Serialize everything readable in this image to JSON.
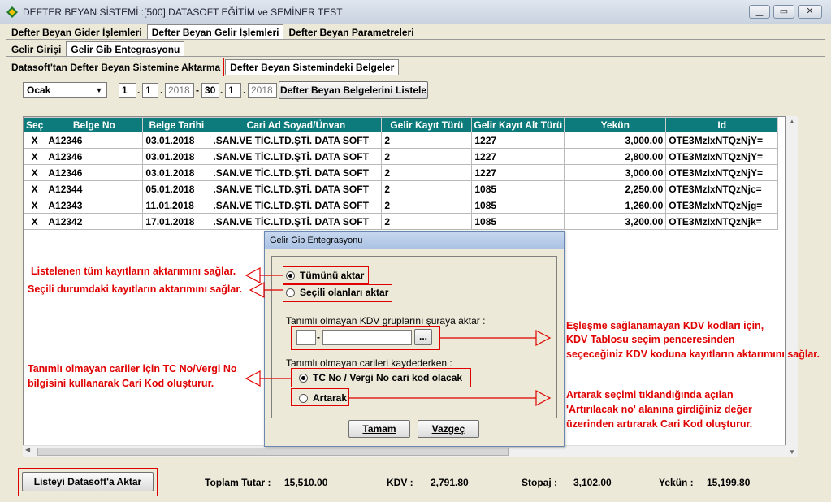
{
  "window": {
    "title": "DEFTER BEYAN SİSTEMİ :[500]  DATASOFT EĞİTİM ve SEMİNER TEST"
  },
  "tabs_main": [
    "Defter Beyan Gider İşlemleri",
    "Defter Beyan Gelir İşlemleri",
    "Defter Beyan Parametreleri"
  ],
  "tabs_sub": [
    "Gelir Girişi",
    "Gelir Gib Entegrasyonu"
  ],
  "tabs_sub2": [
    "Datasoft'tan Defter Beyan Sistemine Aktarma",
    "Defter Beyan Sistemindeki Belgeler"
  ],
  "filter": {
    "month": "Ocak",
    "d1": "1",
    "m1": "1",
    "y1": "2018",
    "d2": "30",
    "m2": "1",
    "y2": "2018",
    "list_button": "Defter Beyan Belgelerini Listele"
  },
  "grid": {
    "columns": [
      "Seç",
      "Belge No",
      "Belge Tarihi",
      "Cari Ad Soyad/Ünvan",
      "Gelir Kayıt Türü",
      "Gelir Kayıt Alt Türü",
      "Yekün",
      "Id"
    ],
    "rows": [
      [
        "X",
        "A12346",
        "03.01.2018",
        ".SAN.VE TİC.LTD.ŞTİ. DATA SOFT",
        "2",
        "1227",
        "3,000.00",
        "OTE3MzIxNTQzNjY="
      ],
      [
        "X",
        "A12346",
        "03.01.2018",
        ".SAN.VE TİC.LTD.ŞTİ. DATA SOFT",
        "2",
        "1227",
        "2,800.00",
        "OTE3MzIxNTQzNjY="
      ],
      [
        "X",
        "A12346",
        "03.01.2018",
        ".SAN.VE TİC.LTD.ŞTİ. DATA SOFT",
        "2",
        "1227",
        "3,000.00",
        "OTE3MzIxNTQzNjY="
      ],
      [
        "X",
        "A12344",
        "05.01.2018",
        ".SAN.VE TİC.LTD.ŞTİ. DATA SOFT",
        "2",
        "1085",
        "2,250.00",
        "OTE3MzIxNTQzNjc="
      ],
      [
        "X",
        "A12343",
        "11.01.2018",
        ".SAN.VE TİC.LTD.ŞTİ. DATA SOFT",
        "2",
        "1085",
        "1,260.00",
        "OTE3MzIxNTQzNjg="
      ],
      [
        "X",
        "A12342",
        "17.01.2018",
        ".SAN.VE TİC.LTD.ŞTİ. DATA SOFT",
        "2",
        "1085",
        "3,200.00",
        "OTE3MzIxNTQzNjk="
      ]
    ]
  },
  "dialog": {
    "title": "Gelir Gib Entegrasyonu",
    "opt_all": "Tümünü aktar",
    "opt_selected": "Seçili olanları aktar",
    "kdv_label": "Tanımlı olmayan KDV gruplarını şuraya aktar :",
    "browse": "...",
    "cari_label": "Tanımlı olmayan carileri kaydederken :",
    "opt_tc": "TC No / Vergi No cari kod olacak",
    "opt_artarak": "Artarak",
    "ok": "Tamam",
    "cancel": "Vazgeç"
  },
  "notes": {
    "n1": "Listelenen tüm kayıtların aktarımını sağlar.",
    "n2": "Seçili durumdaki kayıtların aktarımını sağlar.",
    "n3a": "Tanımlı olmayan cariler için TC No/Vergi No",
    "n3b": "bilgisini kullanarak  Cari Kod oluşturur.",
    "n4a": "Eşleşme sağlanamayan KDV kodları için,",
    "n4b": "KDV Tablosu seçim penceresinden",
    "n4c": "seçeceğiniz KDV koduna kayıtların aktarımını sağlar.",
    "n5a": "Artarak seçimi tıklandığında açılan",
    "n5b": "'Artırılacak no' alanına girdiğiniz değer",
    "n5c": "üzerinden artırarak Cari Kod oluşturur."
  },
  "footer": {
    "transfer_button": "Listeyi Datasoft'a Aktar",
    "total_label": "Toplam Tutar :",
    "total": "15,510.00",
    "kdv_label": "KDV :",
    "kdv": "2,791.80",
    "stopaj_label": "Stopaj :",
    "stopaj": "3,102.00",
    "yekun_label": "Yekün :",
    "yekun": "15,199.80"
  }
}
